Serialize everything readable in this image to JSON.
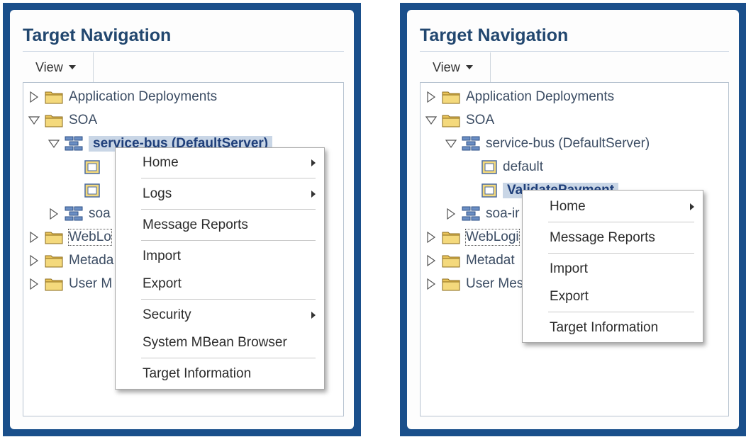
{
  "left": {
    "title": "Target Navigation",
    "view_label": "View",
    "tree": {
      "app_deployments": "Application Deployments",
      "soa": "SOA",
      "service_bus": "service-bus (DefaultServer)",
      "soa_infra": "soa",
      "weblogic": "WebLo",
      "metadata": "Metada",
      "user_messaging": "User M"
    },
    "menu": {
      "home": "Home",
      "logs": "Logs",
      "message_reports": "Message Reports",
      "import": "Import",
      "export": "Export",
      "security": "Security",
      "mbean": "System MBean Browser",
      "target_info": "Target Information"
    }
  },
  "right": {
    "title": "Target Navigation",
    "view_label": "View",
    "tree": {
      "app_deployments": "Application Deployments",
      "soa": "SOA",
      "service_bus": "service-bus (DefaultServer)",
      "default": "default",
      "validate_payment": "ValidatePayment",
      "soa_infra": "soa-ir",
      "weblogic": "WebLogi",
      "metadata": "Metadat",
      "user_messaging": "User Mes"
    },
    "menu": {
      "home": "Home",
      "message_reports": "Message Reports",
      "import": "Import",
      "export": "Export",
      "target_info": "Target Information"
    }
  }
}
